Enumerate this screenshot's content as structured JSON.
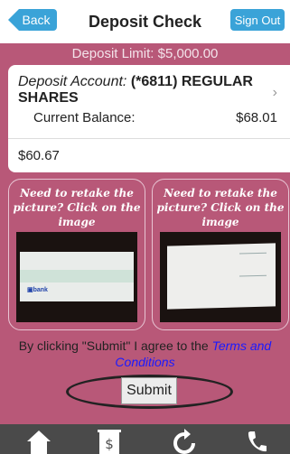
{
  "header": {
    "back_label": "Back",
    "title": "Deposit Check",
    "signout_label": "Sign Out"
  },
  "limit_text": "Deposit Limit: $5,000.00",
  "account": {
    "label": "Deposit Account:",
    "name": "(*6811) REGULAR SHARES",
    "balance_label": "Current Balance:",
    "balance_value": "$68.01"
  },
  "amount": "$60.67",
  "images": {
    "front_text": "Need to retake the picture? Click on the image",
    "back_text": "Need to retake the picture? Click on the image"
  },
  "agreement": {
    "prefix": "By clicking \"Submit\" I agree to the",
    "link": "Terms and Conditions"
  },
  "submit_label": "Submit",
  "nav": [
    "home-icon",
    "deposit-icon",
    "refresh-icon",
    "phone-icon"
  ],
  "colors": {
    "background": "#b85878",
    "button": "#3aa3d8",
    "footer": "#4a4a4a",
    "link": "#1a1aff"
  }
}
